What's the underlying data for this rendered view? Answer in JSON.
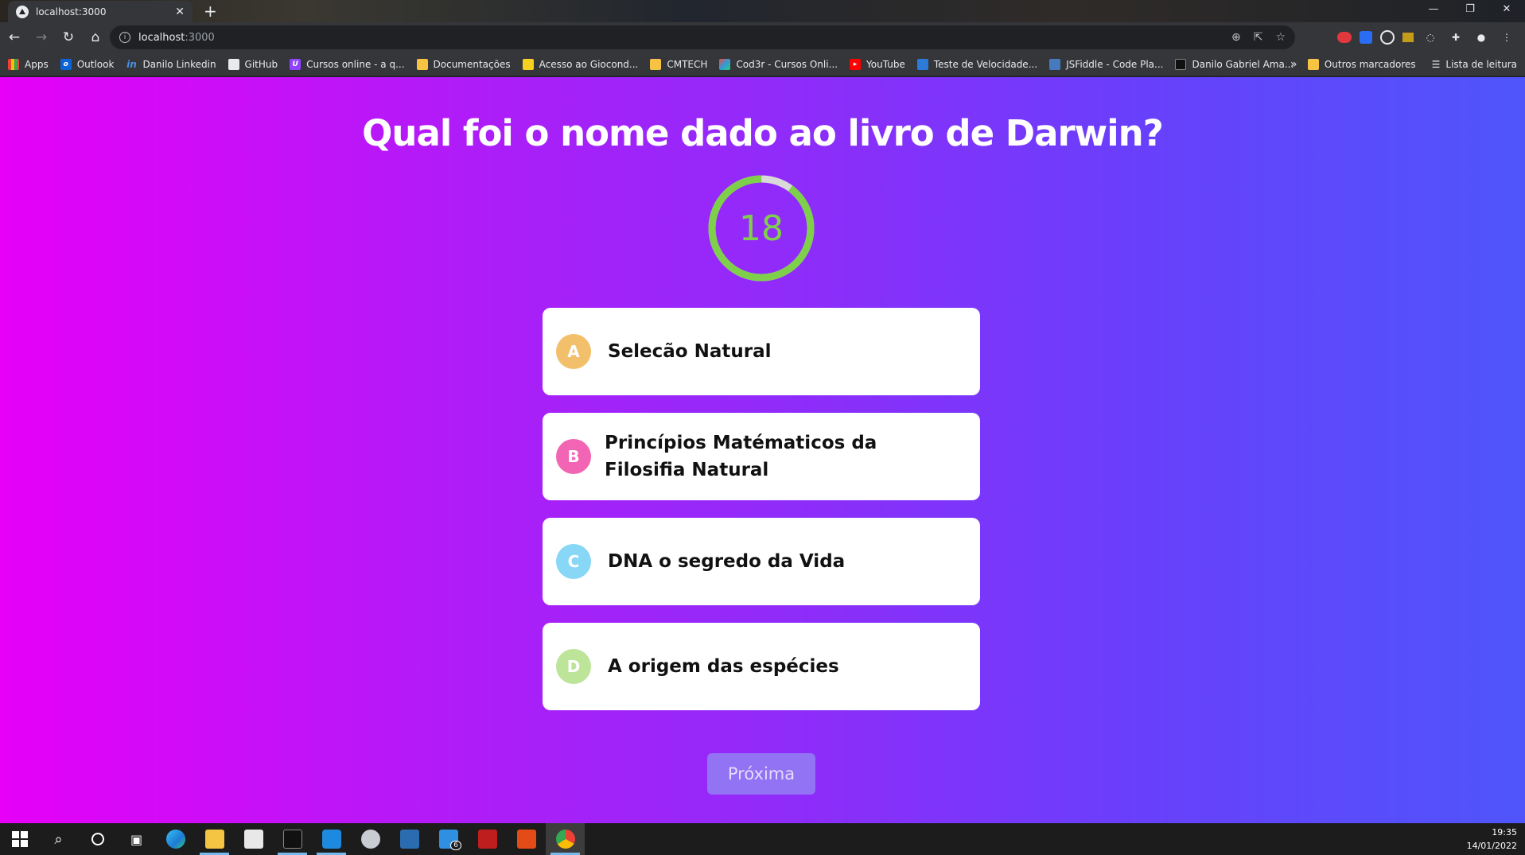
{
  "browser": {
    "tab_title": "localhost:3000",
    "tab_close": "✕",
    "new_tab": "+",
    "address_host": "localhost",
    "address_port": ":3000",
    "window_controls": [
      "—",
      "❐",
      "✕"
    ]
  },
  "bookmarks": {
    "items": [
      {
        "label": "Apps",
        "icon": "apps-grid-icon"
      },
      {
        "label": "Outlook",
        "icon": "outlook-icon"
      },
      {
        "label": "Danilo Linkedin",
        "icon": "linkedin-icon"
      },
      {
        "label": "GitHub",
        "icon": "github-icon"
      },
      {
        "label": "Cursos online - a q...",
        "icon": "course-icon"
      },
      {
        "label": "Documentações",
        "icon": "folder-icon"
      },
      {
        "label": "Acesso ao Giocond...",
        "icon": "chart-icon"
      },
      {
        "label": "CMTECH",
        "icon": "folder-icon"
      },
      {
        "label": "Cod3r - Cursos Onli...",
        "icon": "cod3r-icon"
      },
      {
        "label": "YouTube",
        "icon": "youtube-icon"
      },
      {
        "label": "Teste de Velocidade...",
        "icon": "speedtest-icon"
      },
      {
        "label": "JSFiddle - Code Pla...",
        "icon": "jsfiddle-icon"
      },
      {
        "label": "Danilo Gabriel Ama...",
        "icon": "bookmark-icon"
      }
    ],
    "more": "»",
    "other": "Outros marcadores",
    "reading_list": "Lista de leitura"
  },
  "quiz": {
    "question": "Qual foi o nome dado ao livro de Darwin?",
    "timer_value": "18",
    "timer_total": 20,
    "timer_remaining_fraction": 0.9,
    "timer_color": "#7ed04b",
    "answers": [
      {
        "letter": "A",
        "text": "Selecão Natural",
        "color": "#f2c06b"
      },
      {
        "letter": "B",
        "text": "Princípios Matématicos da Filosifia Natural",
        "color": "#f265b4"
      },
      {
        "letter": "C",
        "text": "DNA o segredo da Vida",
        "color": "#89d7f6"
      },
      {
        "letter": "D",
        "text": "A origem das espécies",
        "color": "#bde59a"
      }
    ],
    "next_label": "Próxima"
  },
  "taskbar": {
    "time": "19:35",
    "date": "14/01/2022",
    "mail_badge": "6"
  }
}
